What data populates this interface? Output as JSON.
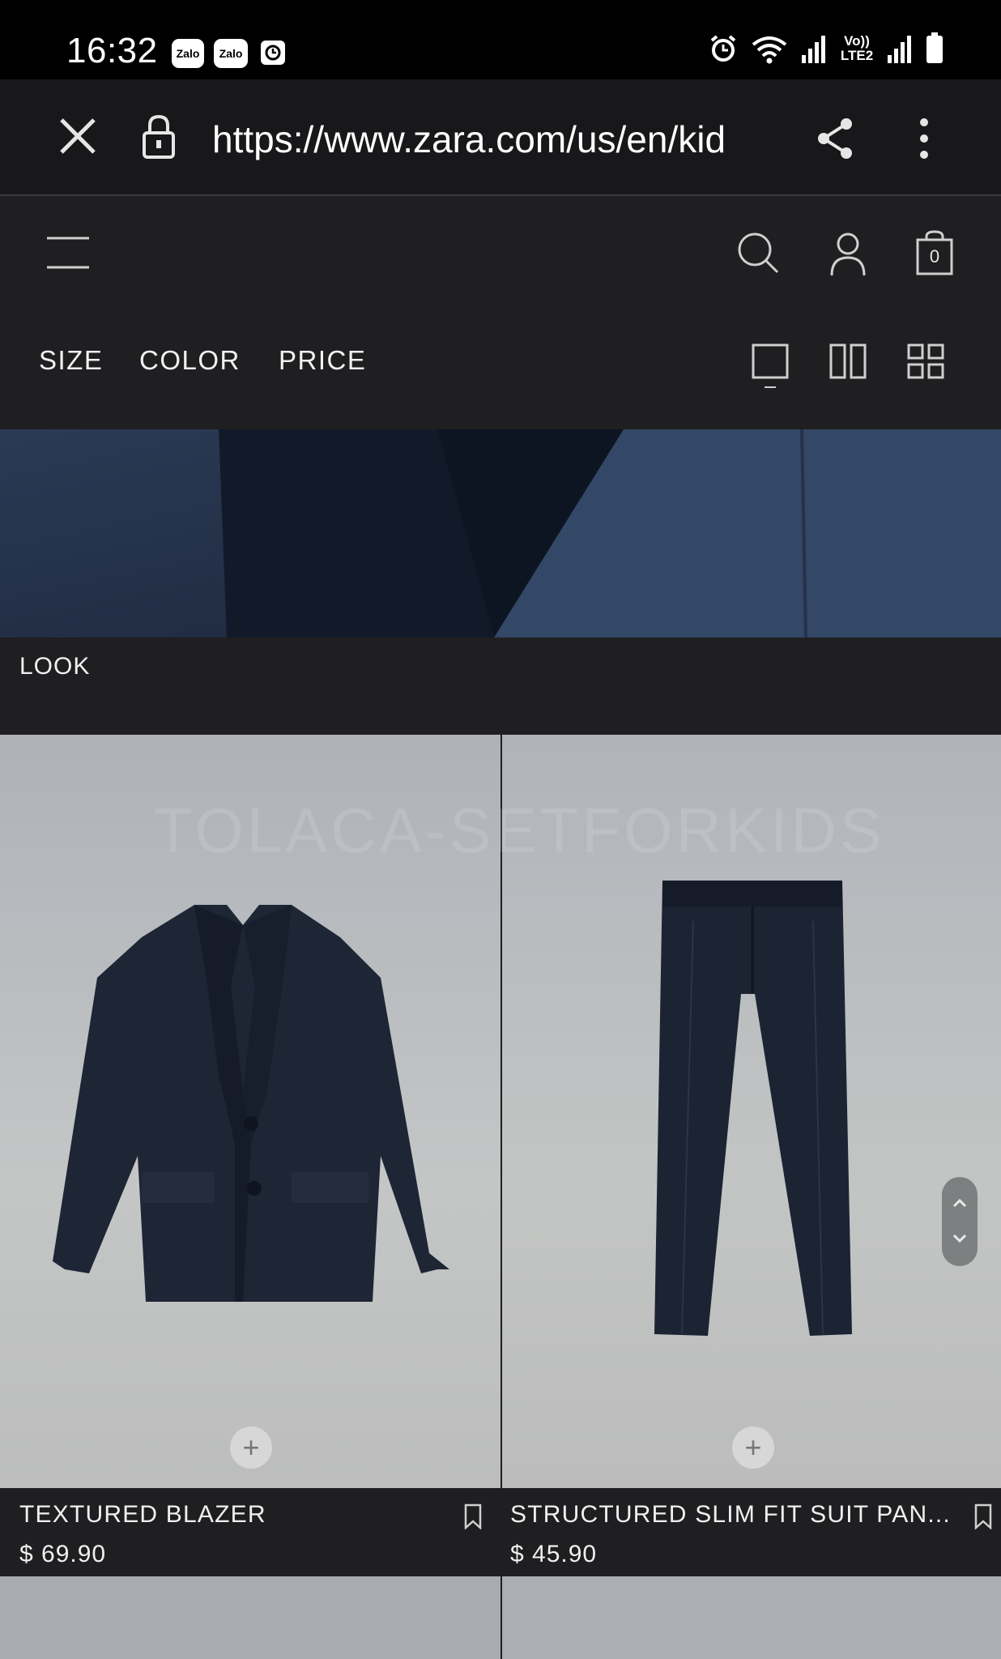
{
  "status_bar": {
    "time": "16:32",
    "notifications": [
      "Zalo",
      "Zalo"
    ],
    "network_label": "Vo)) LTE2"
  },
  "browser": {
    "url": "https://www.zara.com/us/en/kid"
  },
  "header": {
    "cart_count": "0"
  },
  "filters": [
    "SIZE",
    "COLOR",
    "PRICE"
  ],
  "section": {
    "label": "LOOK"
  },
  "watermark": "TOLACA-SETFORKIDS",
  "products": [
    {
      "name": "TEXTURED BLAZER",
      "price": "$ 69.90"
    },
    {
      "name": "STRUCTURED SLIM FIT SUIT PAN...",
      "price": "$ 45.90"
    }
  ],
  "colors": {
    "background": "#1f1f21",
    "status_bar": "#000000",
    "product_bg": "#b9bcbf",
    "garment": "#1c2333"
  }
}
